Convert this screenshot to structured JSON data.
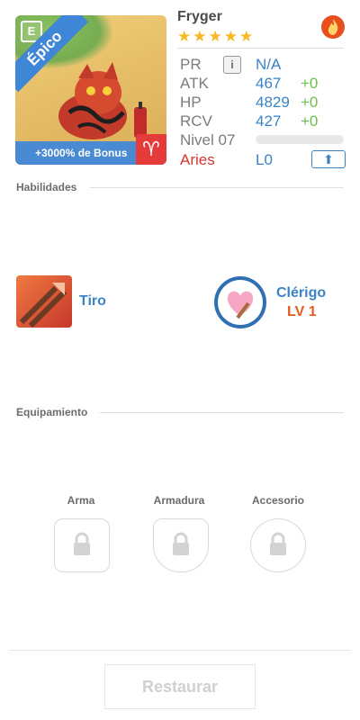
{
  "card": {
    "rarity": "Épico",
    "element_letter": "E",
    "bonus": "+3000% de Bonus",
    "zodiac_symbol": "♈"
  },
  "monster": {
    "name": "Fryger",
    "stars": 5
  },
  "stats": {
    "pr": {
      "label": "PR",
      "value": "N/A"
    },
    "atk": {
      "label": "ATK",
      "value": "467",
      "plus": "+0"
    },
    "hp": {
      "label": "HP",
      "value": "4829",
      "plus": "+0"
    },
    "rcv": {
      "label": "RCV",
      "value": "427",
      "plus": "+0"
    },
    "level": {
      "label": "Nivel 07",
      "progress": 0
    },
    "sign": {
      "label": "Aries",
      "value": "L0"
    }
  },
  "sections": {
    "skills": "Habilidades",
    "equipment": "Equipamiento"
  },
  "skill": {
    "name": "Tiro"
  },
  "class": {
    "name": "Clérigo",
    "level": "LV 1"
  },
  "slots": {
    "weapon": "Arma",
    "armor": "Armadura",
    "accessory": "Accesorio"
  },
  "footer": {
    "restore_label": "Restaurar"
  },
  "colors": {
    "blue": "#3b83c7",
    "green": "#6ec04c",
    "red": "#e53b3b",
    "orange": "#e75a1f"
  }
}
